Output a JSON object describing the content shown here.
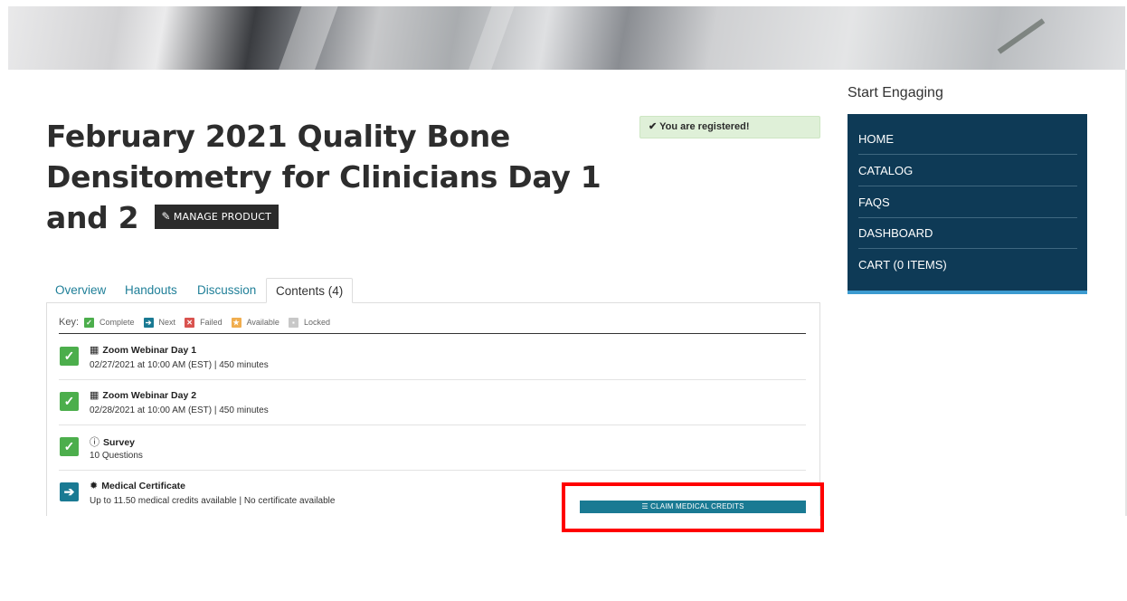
{
  "page": {
    "title": "February 2021 Quality Bone Densitometry for Clinicians Day 1 and 2",
    "manage_button_label": "MANAGE PRODUCT",
    "registered_text": "You are registered!"
  },
  "tabs": [
    {
      "label": "Overview",
      "active": false
    },
    {
      "label": "Handouts",
      "active": false
    },
    {
      "label": "Discussion",
      "active": false
    },
    {
      "label": "Contents (4)",
      "active": true
    }
  ],
  "key": {
    "label": "Key:",
    "items": [
      {
        "label": "Complete",
        "color": "#4cae4c",
        "icon": "check-icon"
      },
      {
        "label": "Next",
        "color": "#1a7a93",
        "icon": "arrow-right-icon"
      },
      {
        "label": "Failed",
        "color": "#d9534f",
        "icon": "x-icon"
      },
      {
        "label": "Available",
        "color": "#f0ad4e",
        "icon": "star-icon"
      },
      {
        "label": "Locked",
        "color": "#c8c8c8",
        "icon": "lock-icon"
      }
    ]
  },
  "contents": [
    {
      "status": "complete",
      "icon": "calendar-icon",
      "title": "Zoom Webinar Day 1",
      "meta": "02/27/2021 at 10:00 AM (EST)  |  450 minutes"
    },
    {
      "status": "complete",
      "icon": "calendar-icon",
      "title": "Zoom Webinar Day 2",
      "meta": "02/28/2021 at 10:00 AM (EST)  |  450 minutes"
    },
    {
      "status": "complete",
      "icon": "info-circle-icon",
      "title": "Survey",
      "meta": "10 Questions"
    },
    {
      "status": "next",
      "icon": "certificate-icon",
      "title": "Medical Certificate",
      "meta": "Up to 11.50 medical credits available  |  No certificate available"
    }
  ],
  "claim_button_label": "CLAIM MEDICAL CREDITS",
  "sidebar": {
    "heading": "Start Engaging",
    "items": [
      {
        "label": "HOME"
      },
      {
        "label": "CATALOG"
      },
      {
        "label": "FAQS"
      },
      {
        "label": "DASHBOARD"
      },
      {
        "label": "CART (0 ITEMS)"
      }
    ]
  },
  "colors": {
    "complete": "#4cae4c",
    "next": "#1a7a93",
    "nav_bg": "#0e3a56",
    "highlight": "#ff0000"
  }
}
